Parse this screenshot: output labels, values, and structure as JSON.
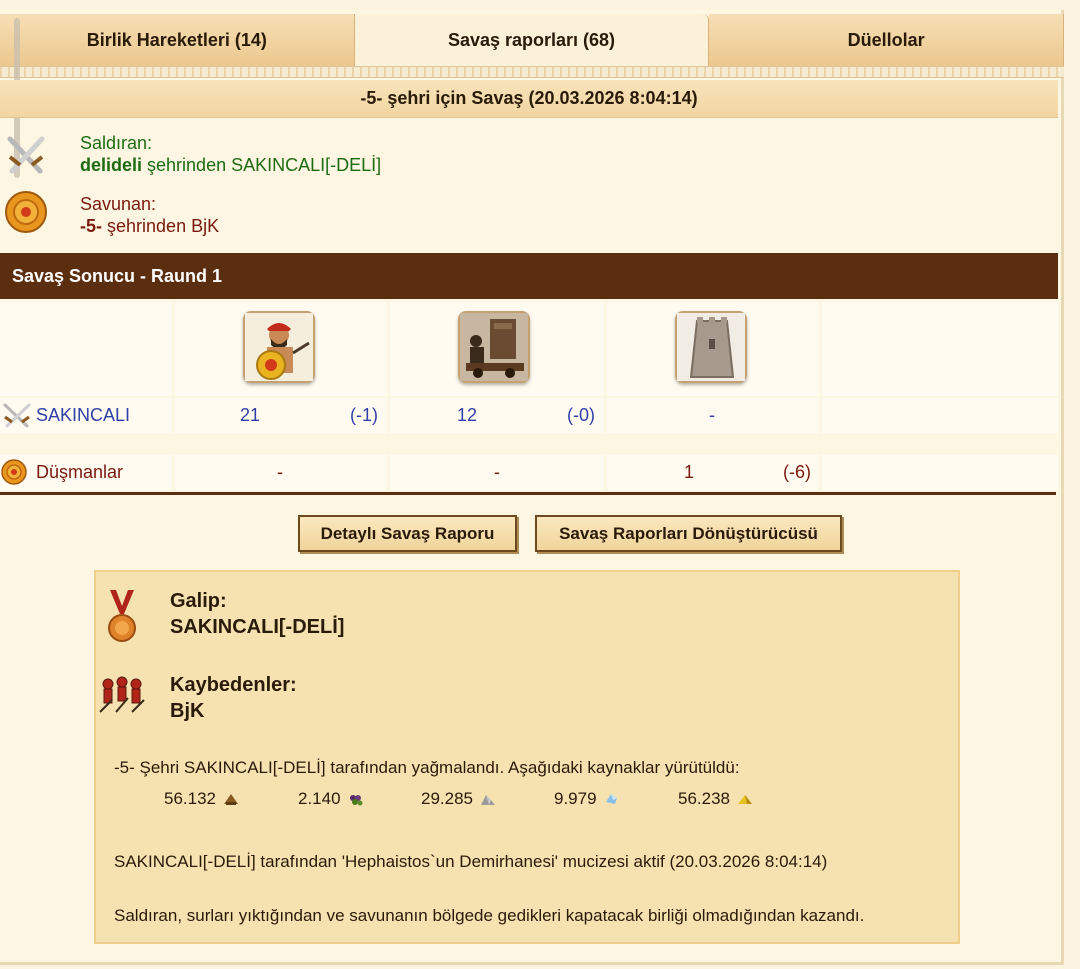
{
  "tabs": [
    {
      "label": "Birlik Hareketleri (14)",
      "active": false
    },
    {
      "label": "Savaş raporları (68)",
      "active": true
    },
    {
      "label": "Düellolar",
      "active": false
    }
  ],
  "report": {
    "title": "-5- şehri için Savaş (20.03.2026 8:04:14)",
    "attacker": {
      "label": "Saldıran:",
      "city": "delideli",
      "city_suffix": "şehrinden SAKINCALI[-DELİ]"
    },
    "defender": {
      "label": "Savunan:",
      "city": "-5-",
      "city_suffix": "şehrinden BjK"
    }
  },
  "result_bar": "Savaş Sonucu - Raund 1",
  "units": [
    {
      "icon": "hoplite-icon"
    },
    {
      "icon": "catapult-icon"
    },
    {
      "icon": "wall-icon"
    }
  ],
  "rows": {
    "attacker": {
      "name": "SAKINCALI",
      "cells": [
        {
          "count": "21",
          "loss": "(-1)"
        },
        {
          "count": "12",
          "loss": "(-0)"
        },
        {
          "count": "-",
          "loss": ""
        }
      ]
    },
    "enemies": {
      "name": "Düşmanlar",
      "cells": [
        {
          "count": "-",
          "loss": ""
        },
        {
          "count": "-",
          "loss": ""
        },
        {
          "count": "1",
          "loss": "(-6)"
        }
      ]
    }
  },
  "buttons": {
    "detailed": "Detaylı Savaş Raporu",
    "converter": "Savaş Raporları Dönüştürücüsü"
  },
  "outcome": {
    "winner_label": "Galip:",
    "winner": "SAKINCALI[-DELİ]",
    "losers_label": "Kaybedenler:",
    "losers": "BjK",
    "plunder_text": "-5- Şehri SAKINCALI[-DELİ] tarafından yağmalandı. Aşağıdaki kaynaklar yürütüldü:",
    "resources": [
      {
        "amount": "56.132",
        "icon": "wood-icon"
      },
      {
        "amount": "2.140",
        "icon": "grapes-icon"
      },
      {
        "amount": "29.285",
        "icon": "marble-icon"
      },
      {
        "amount": "9.979",
        "icon": "crystal-icon"
      },
      {
        "amount": "56.238",
        "icon": "sulfur-icon"
      }
    ],
    "miracle_text": "SAKINCALI[-DELİ] tarafından 'Hephaistos`un Demirhanesi' mucizesi aktif (20.03.2026 8:04:14)",
    "reason_text": "Saldıran, surları yıktığından ve savunanın bölgede gedikleri kapatacak birliği olmadığından kazandı."
  }
}
